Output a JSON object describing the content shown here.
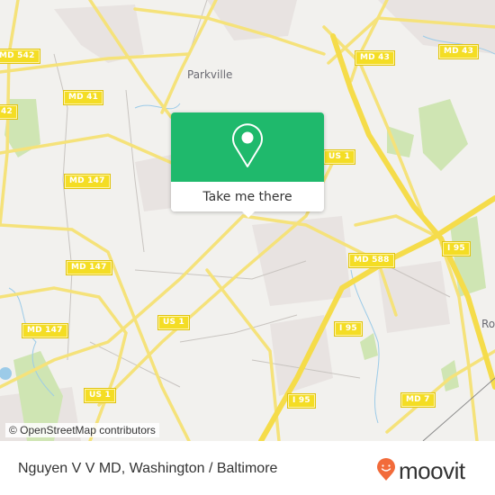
{
  "map": {
    "place_labels": [
      {
        "id": "parkville",
        "text": "Parkville"
      },
      {
        "id": "rosedale",
        "text": "Ro"
      }
    ],
    "road_shields": [
      {
        "id": "md542",
        "text": "MD 542"
      },
      {
        "id": "md43a",
        "text": "MD 43"
      },
      {
        "id": "md43b",
        "text": "MD 43"
      },
      {
        "id": "md41",
        "text": "MD 41"
      },
      {
        "id": "md542b",
        "text": "42"
      },
      {
        "id": "us1a",
        "text": "US 1"
      },
      {
        "id": "md147a",
        "text": "MD 147"
      },
      {
        "id": "md147b",
        "text": "MD 147"
      },
      {
        "id": "md147c",
        "text": "MD 147"
      },
      {
        "id": "md588",
        "text": "MD 588"
      },
      {
        "id": "i95a",
        "text": "I 95"
      },
      {
        "id": "us1b",
        "text": "US 1"
      },
      {
        "id": "i95b",
        "text": "I 95"
      },
      {
        "id": "us1c",
        "text": "US 1"
      },
      {
        "id": "i95c",
        "text": "I 95"
      },
      {
        "id": "md7",
        "text": "MD 7"
      }
    ],
    "attribution": "© OpenStreetMap contributors"
  },
  "popup": {
    "icon": "map-pin-icon",
    "button_label": "Take me there",
    "accent_color": "#1fb96c"
  },
  "footer": {
    "title": "Nguyen V V MD, Washington / Baltimore",
    "logo_text": "moovit",
    "logo_color": "#f26b3a"
  }
}
